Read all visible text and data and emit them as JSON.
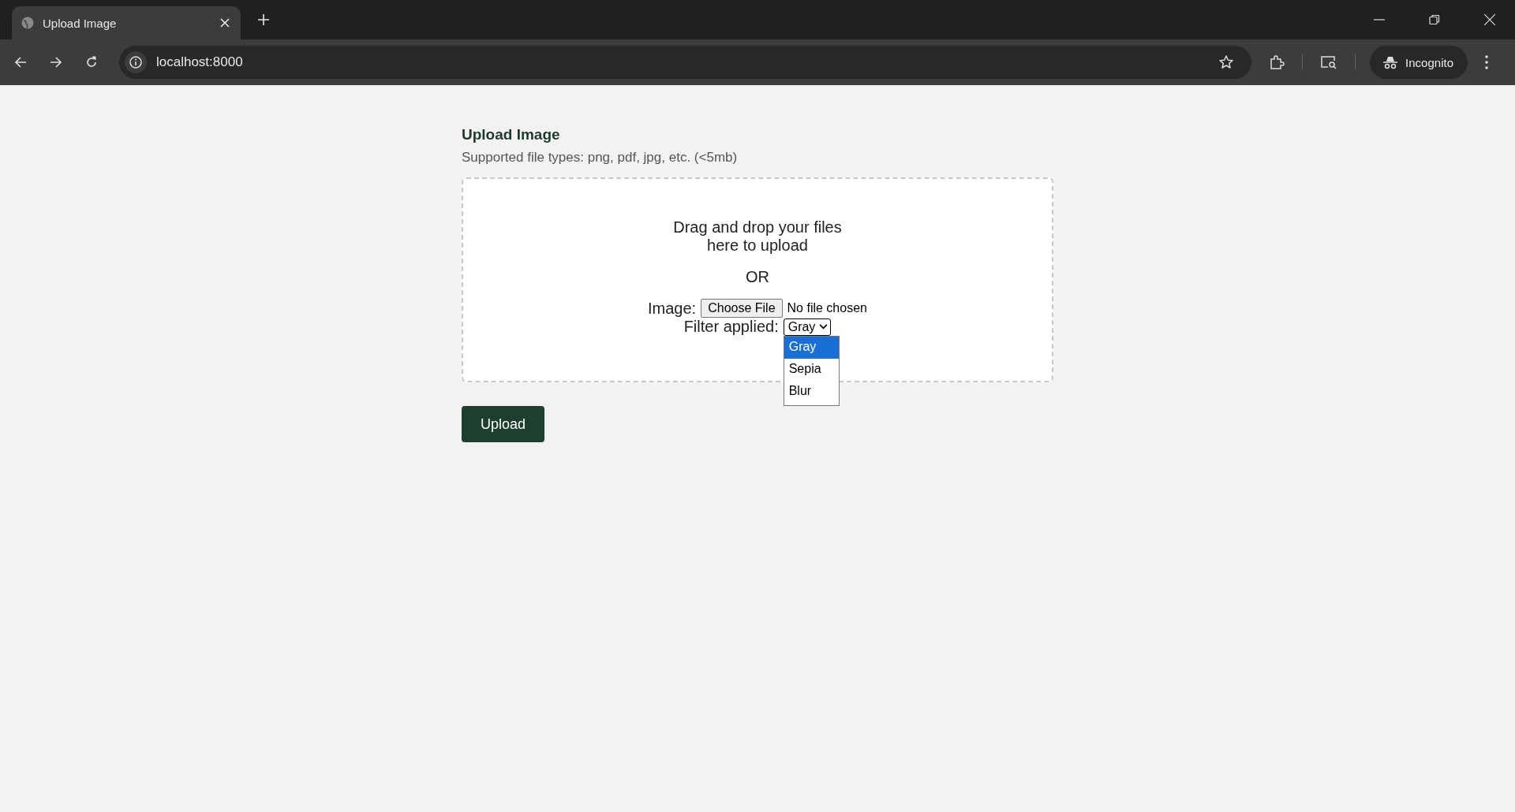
{
  "browser": {
    "tab_title": "Upload Image",
    "address": "localhost:8000",
    "profile": "Incognito"
  },
  "form": {
    "title": "Upload Image",
    "subtitle": "Supported file types: png, pdf, jpg, etc. (<5mb)",
    "drop_text": [
      "Drag and drop your files",
      "here to upload"
    ],
    "or_text": "OR",
    "image_label": "Image:",
    "file_button": "Choose File",
    "file_status": "No file chosen",
    "filter_label": "Filter applied:",
    "filter_value": "Gray",
    "dropdown_expanded": true,
    "filter_options": [
      {
        "label": "Gray",
        "selected": true
      },
      {
        "label": "Sepia",
        "selected": false
      },
      {
        "label": "Blur",
        "selected": false
      }
    ],
    "submit": "Upload"
  }
}
